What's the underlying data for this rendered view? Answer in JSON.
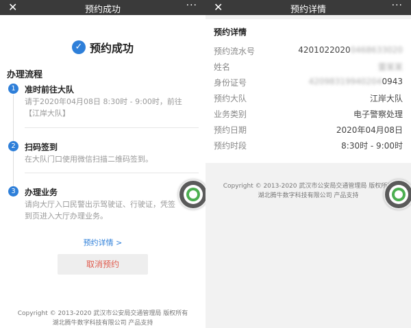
{
  "left": {
    "topbar": {
      "close": "✕",
      "title": "预约成功",
      "more": "···"
    },
    "success": {
      "check": "✓",
      "text": "预约成功"
    },
    "process_title": "办理流程",
    "steps": [
      {
        "num": "1",
        "name": "准时前往大队",
        "desc": "请于2020年04月08日 8:30时 - 9:00时，前往【江岸大队】"
      },
      {
        "num": "2",
        "name": "扫码签到",
        "desc": "在大队门口使用微信扫描二维码签到。"
      },
      {
        "num": "3",
        "name": "办理业务",
        "desc": "请向大厅入口民警出示驾驶证、行驶证，凭签到页进入大厅办理业务。"
      }
    ],
    "detail_link": "预约详情 >",
    "cancel": "取消预约",
    "footer_line1": "Copyright © 2013-2020 武汉市公安局交通管理局 版权所有",
    "footer_line2": "湖北腾牛数字科技有限公司 产品支持"
  },
  "right": {
    "topbar": {
      "close": "✕",
      "title": "预约详情",
      "more": "···"
    },
    "detail_title": "预约详情",
    "rows": [
      {
        "key": "预约流水号",
        "value": "4201022020",
        "blurred": "0468633020"
      },
      {
        "key": "姓名",
        "value": "",
        "blurred": "雷某某"
      },
      {
        "key": "身份证号",
        "value": "0943",
        "blurred": "42098319940204"
      },
      {
        "key": "预约大队",
        "value": "江岸大队",
        "blurred": ""
      },
      {
        "key": "业务类别",
        "value": "电子警察处理",
        "blurred": ""
      },
      {
        "key": "预约日期",
        "value": "2020年04月08日",
        "blurred": ""
      },
      {
        "key": "预约时段",
        "value": "8:30时 - 9:00时",
        "blurred": ""
      }
    ],
    "footer_line1": "Copyright © 2013-2020 武汉市公安局交通管理局 版权所有",
    "footer_line2": "湖北腾牛数字科技有限公司 产品支持"
  },
  "colors": {
    "accent": "#2e7fd9",
    "danger": "#e05b4d",
    "topbar": "#3a3a3a"
  },
  "icons": {
    "fab": "green-circular-logo-icon"
  }
}
